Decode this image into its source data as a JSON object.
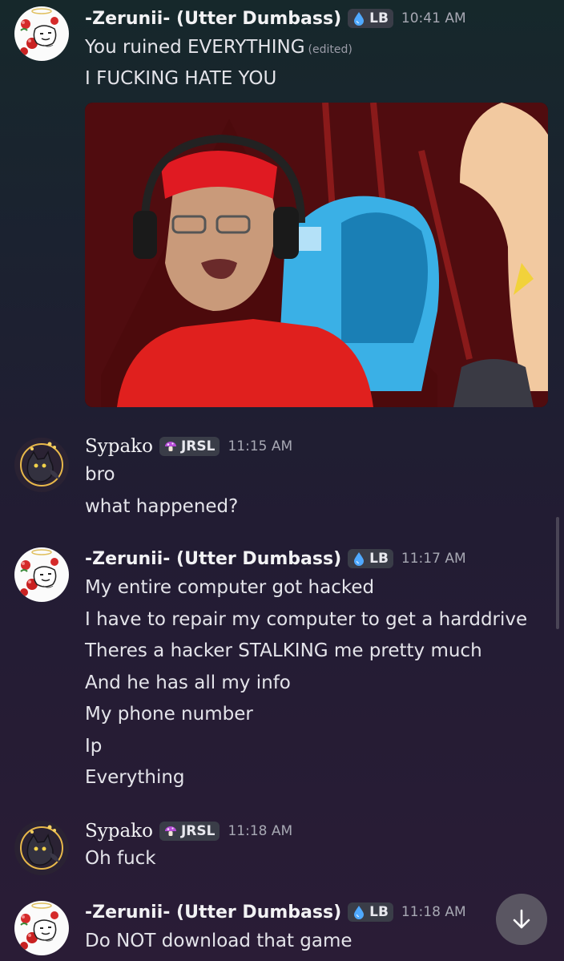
{
  "colors": {
    "accent_lb": "#4fa9ff",
    "accent_jrsl": "#b64cd6",
    "background": "#221c33",
    "text": "#e4e4ea",
    "muted": "#a7a8b3"
  },
  "messages": [
    {
      "user": "-Zerunii- (Utter Dumbass)",
      "tag": "LB",
      "tag_icon": "water-drop-icon",
      "time": "10:41 AM",
      "lines": [
        "You ruined EVERYTHING",
        "I FUCKING HATE YOU"
      ],
      "edited_label": "(edited)",
      "attachment": "gif-image"
    },
    {
      "user": "Sypako",
      "tag": "JRSL",
      "tag_icon": "mushroom-icon",
      "time": "11:15 AM",
      "lines": [
        "bro",
        "what happened?"
      ]
    },
    {
      "user": "-Zerunii- (Utter Dumbass)",
      "tag": "LB",
      "tag_icon": "water-drop-icon",
      "time": "11:17 AM",
      "lines": [
        "My entire computer got hacked",
        "I have to repair my computer to get a harddrive",
        "Theres a hacker STALKING me pretty much",
        "And he has all my info",
        "My phone number",
        "Ip",
        "Everything"
      ]
    },
    {
      "user": "Sypako",
      "tag": "JRSL",
      "tag_icon": "mushroom-icon",
      "time": "11:18 AM",
      "lines": [
        "Oh fuck"
      ]
    },
    {
      "user": "-Zerunii- (Utter Dumbass)",
      "tag": "LB",
      "tag_icon": "water-drop-icon",
      "time": "11:18 AM",
      "lines": [
        "Do NOT download that game"
      ]
    }
  ],
  "jump_button_icon": "arrow-down-icon"
}
